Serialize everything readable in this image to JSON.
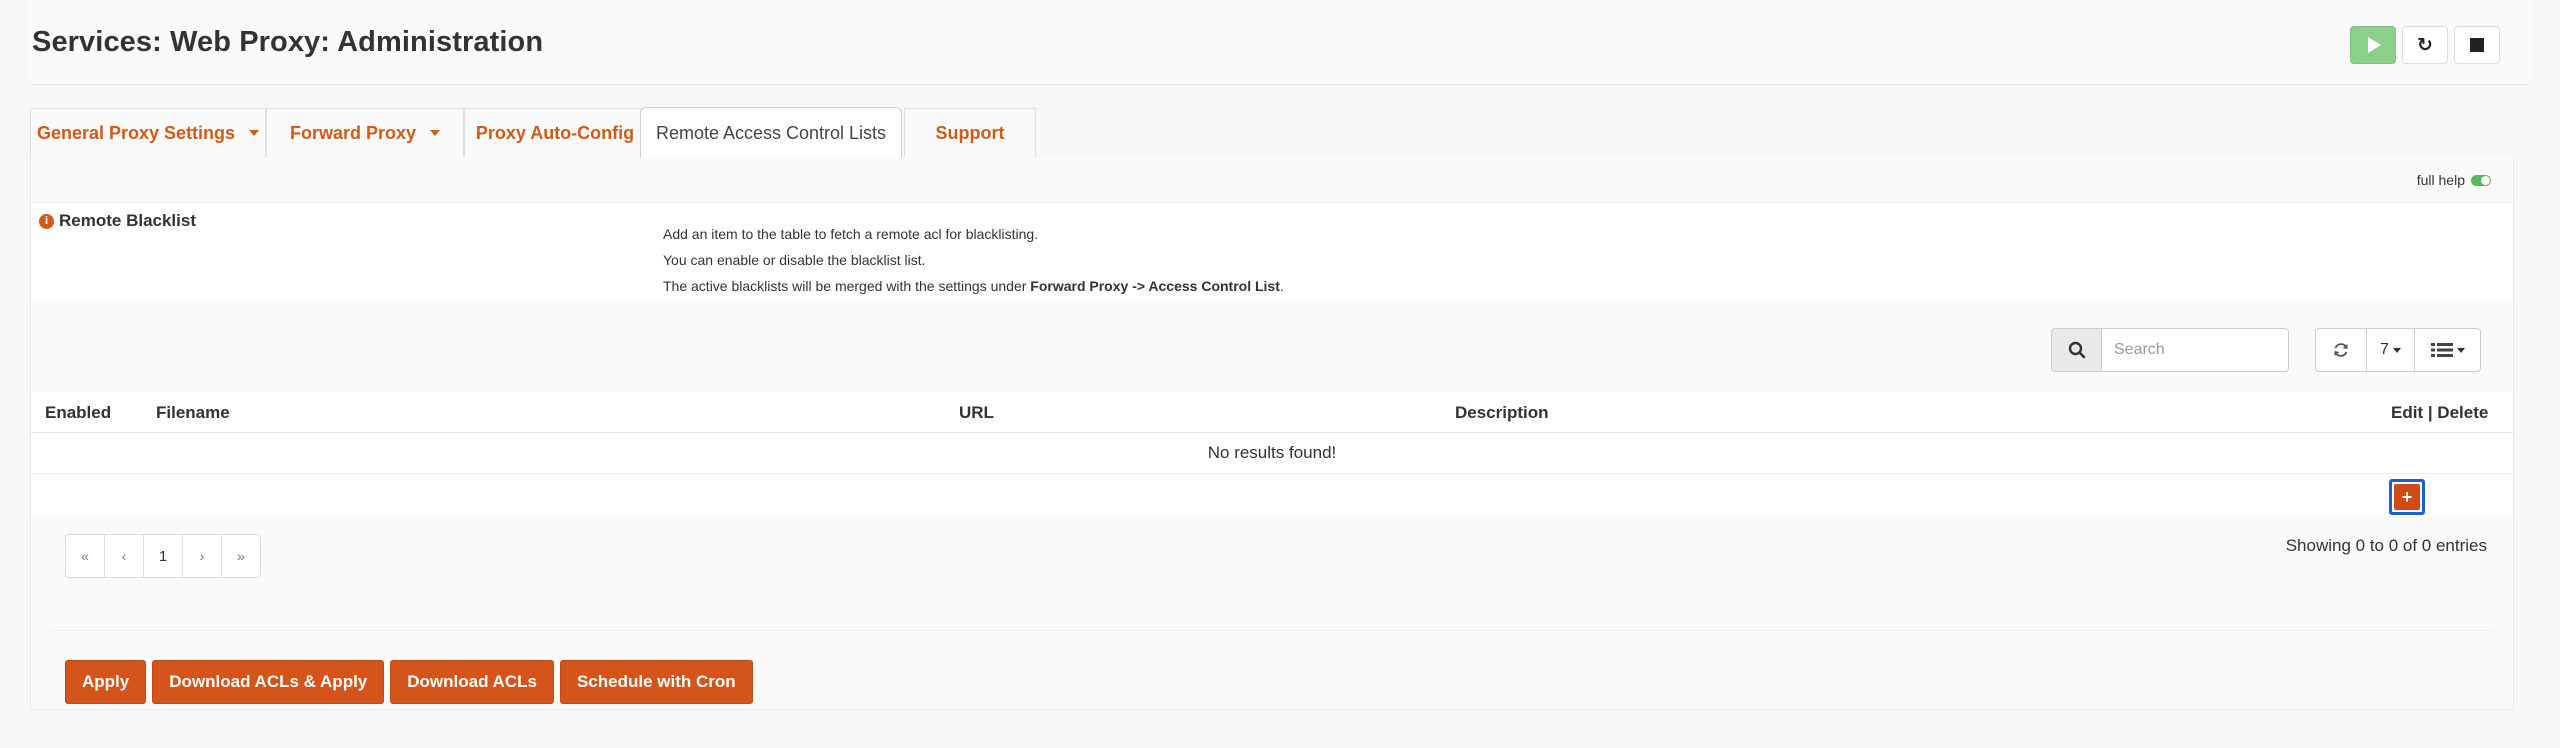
{
  "header": {
    "title": "Services: Web Proxy: Administration"
  },
  "tabs": [
    {
      "label": "General Proxy Settings"
    },
    {
      "label": "Forward Proxy"
    },
    {
      "label": "Proxy Auto-Config"
    },
    {
      "label": "Remote Access Control Lists"
    },
    {
      "label": "Support"
    }
  ],
  "full_help": "full help",
  "section": {
    "label": "Remote Blacklist",
    "help_line1": "Add an item to the table to fetch a remote acl for blacklisting.",
    "help_line2": "You can enable or disable the blacklist list.",
    "help_line3_pre": "The active blacklists will be merged with the settings under ",
    "help_line3_bold": "Forward Proxy -> Access Control List",
    "help_line3_post": "."
  },
  "search": {
    "placeholder": "Search"
  },
  "rows_per_page": "7",
  "table": {
    "columns": [
      "Enabled",
      "Filename",
      "URL",
      "Description",
      "Edit | Delete"
    ],
    "empty_text": "No results found!"
  },
  "pagination": {
    "first": "«",
    "prev": "‹",
    "page": "1",
    "next": "›",
    "last": "»"
  },
  "showing": "Showing 0 to 0 of 0 entries",
  "actions": {
    "apply": "Apply",
    "download_apply": "Download ACLs & Apply",
    "download": "Download ACLs",
    "schedule": "Schedule with Cron"
  },
  "add_symbol": "+",
  "colors": {
    "accent": "#d5541b",
    "start": "#8ad08a",
    "focus": "#1a5fd6"
  }
}
